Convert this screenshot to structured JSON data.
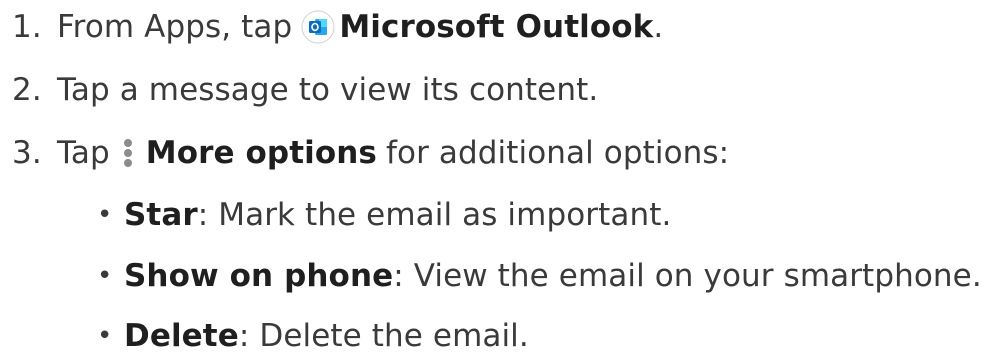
{
  "steps": [
    {
      "number": "1.",
      "prefix": "From Apps, tap",
      "bold": "Microsoft Outlook",
      "suffix": ".",
      "icon": "outlook-app-icon"
    },
    {
      "number": "2.",
      "text": "Tap a message to view its content."
    },
    {
      "number": "3.",
      "prefix": "Tap",
      "bold": "More options",
      "suffix": "for additional options:",
      "icon": "more-options-icon"
    }
  ],
  "options": [
    {
      "name": "Star",
      "desc": ": Mark the email as important."
    },
    {
      "name": "Show on phone",
      "desc": ": View the email on your smartphone."
    },
    {
      "name": "Delete",
      "desc": ": Delete the email."
    }
  ],
  "bullet": "•",
  "colors": {
    "text": "#3a3a3a",
    "bold": "#1f1f1f",
    "outlook_blue": "#0f6cbd",
    "outlook_light": "#28a8ea",
    "more_icon": "#8c8c8c"
  }
}
